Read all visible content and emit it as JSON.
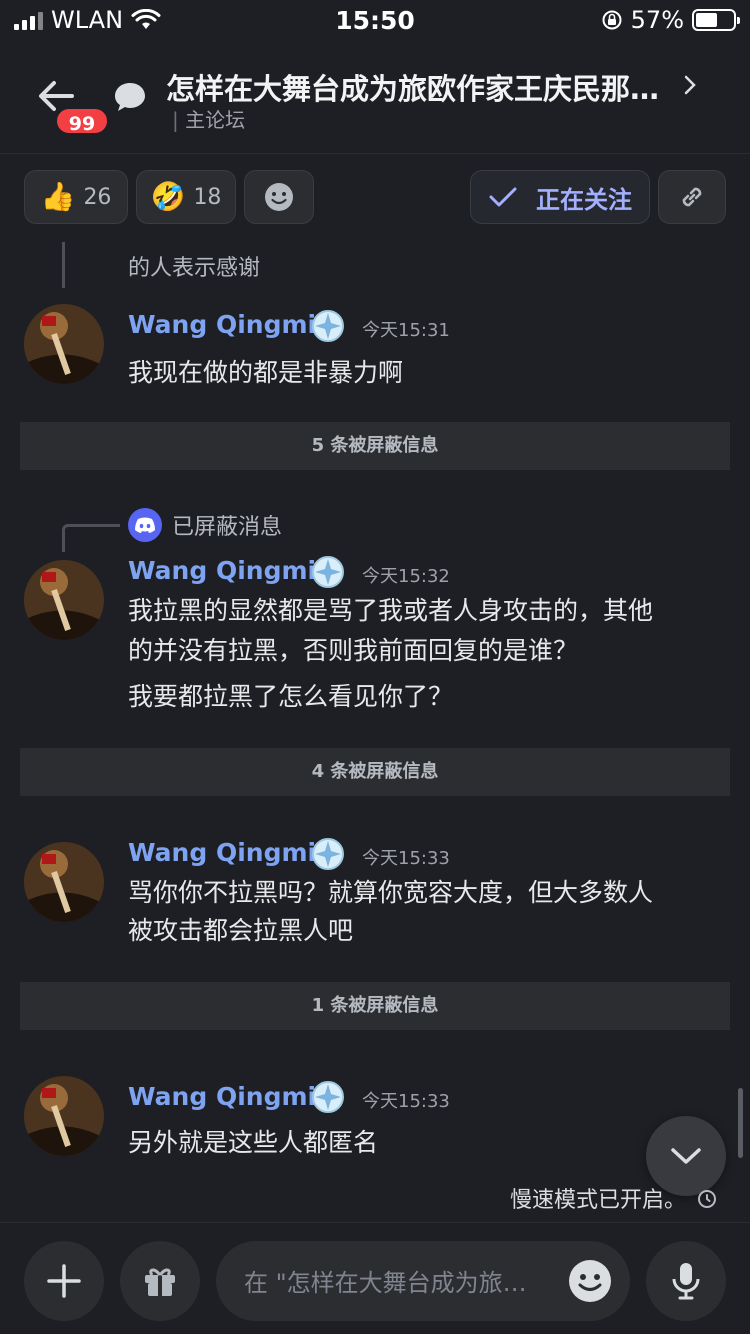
{
  "status_bar": {
    "carrier": "WLAN",
    "time": "15:50",
    "battery": "57%",
    "battery_level": 0.57
  },
  "header": {
    "back_badge": "99",
    "title": "怎样在大舞台成为旅欧作家王庆民那…",
    "subtitle": "主论坛"
  },
  "reactions": [
    {
      "emoji": "👍",
      "count": "26"
    },
    {
      "emoji": "🤣",
      "count": "18"
    }
  ],
  "follow_label": "正在关注",
  "feed": {
    "prev_reply_text": "的人表示感谢",
    "messages": [
      {
        "author": "Wang Qingmin",
        "time": "今天15:31",
        "lines": [
          "我现在做的都是非暴力啊"
        ]
      },
      {
        "author": "Wang Qingmin",
        "time": "今天15:32",
        "reply_to": "已屏蔽消息",
        "lines": [
          "我拉黑的显然都是骂了我或者人身攻击的，其他",
          "的并没有拉黑，否则我前面回复的是谁？",
          "我要都拉黑了怎么看见你了？"
        ]
      },
      {
        "author": "Wang Qingmin",
        "time": "今天15:33",
        "lines": [
          "骂你你不拉黑吗？就算你宽容大度，但大多数人",
          "被攻击都会拉黑人吧"
        ]
      },
      {
        "author": "Wang Qingmin",
        "time": "今天15:33",
        "lines": [
          "另外就是这些人都匿名"
        ]
      }
    ],
    "blocked": [
      "5 条被屏蔽信息",
      "4 条被屏蔽信息",
      "1 条被屏蔽信息"
    ]
  },
  "slowmode": "慢速模式已开启。",
  "composer": {
    "placeholder": "在 \"怎样在大舞台成为旅欧作家王庆民那…\" 中发言"
  },
  "colors": {
    "accent": "#5865f2",
    "name": "#7ea3f0",
    "badge": "#f23f43"
  }
}
